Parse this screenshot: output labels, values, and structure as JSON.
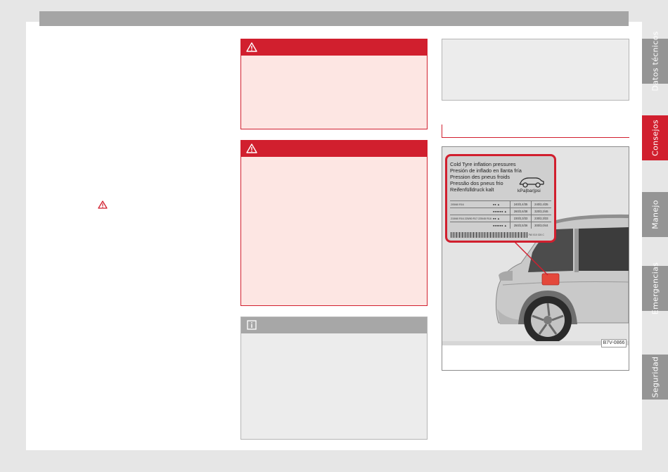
{
  "colors": {
    "accent": "#d11f2e",
    "warning_body": "#fde6e3",
    "note_head": "#a7a7a7",
    "tab_inactive": "#959595",
    "header_bar": "#a5a5a5"
  },
  "icons": {
    "warning": "warning-triangle-icon",
    "info": "info-icon"
  },
  "figure": {
    "code": "B7V-0866",
    "label_card": {
      "lines": [
        "Cold Tyre inflation pressures",
        "Presión de inflado en llanta fría",
        "Pression des pneus froids",
        "Pressão dos pneus frio",
        "Reifenfülldruck kalt"
      ],
      "unit": "kPa|bar|psi",
      "rows": [
        {
          "size": "205/60 R16",
          "load": "",
          "front": "240/2,4/35",
          "rear": "240/2,4/35"
        },
        {
          "size": "",
          "load": "",
          "front": "260/2,6/38",
          "rear": "320/3,2/46"
        },
        {
          "size": "215/60 R16 225/50 R17 225/45 R18",
          "load": "",
          "front": "230/2,3/33",
          "rear": "230/2,3/33"
        },
        {
          "size": "",
          "load": "",
          "front": "250/2,5/36",
          "rear": "300/3,0/44"
        }
      ],
      "code": "7N0 010 024 C"
    }
  },
  "side_tabs": [
    {
      "label": "Datos técnicos",
      "active": false
    },
    {
      "label": "Consejos",
      "active": true
    },
    {
      "label": "Manejo",
      "active": false
    },
    {
      "label": "Emergencias",
      "active": false
    },
    {
      "label": "Seguridad",
      "active": false
    }
  ]
}
